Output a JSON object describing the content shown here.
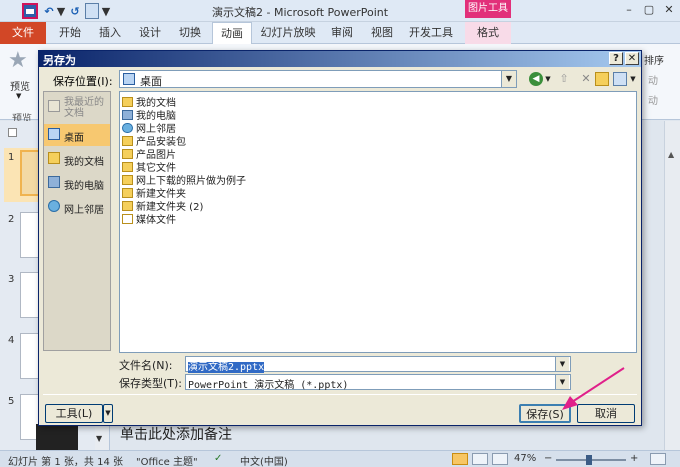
{
  "app": {
    "window_title": "演示文稿2 - Microsoft PowerPoint",
    "context_tab_title": "图片工具",
    "window_controls": {
      "minimize": "–",
      "maximize": "▢",
      "close": "✕"
    }
  },
  "ribbon": {
    "file_tab": "文件",
    "tabs": [
      "开始",
      "插入",
      "设计",
      "切换",
      "动画",
      "幻灯片放映",
      "审阅",
      "视图",
      "开发工具",
      "格式"
    ],
    "active_tab": "动画",
    "preview_button": "预览",
    "preview_group": "预览",
    "sort_label": "排序",
    "faded_1": "动",
    "faded_2": "动"
  },
  "slide_pane": {
    "slide_numbers": [
      "1",
      "2",
      "3",
      "4",
      "5"
    ]
  },
  "notes": {
    "placeholder": "单击此处添加备注"
  },
  "status": {
    "slide_info": "幻灯片 第 1 张，共 14 张",
    "theme": "\"Office 主题\"",
    "language": "中文(中国)",
    "zoom": "47%",
    "zoom_minus": "−",
    "zoom_plus": "+"
  },
  "dialog": {
    "title": "另存为",
    "help": "?",
    "close": "✕",
    "save_in_label": "保存位置(I):",
    "save_in_value": "桌面",
    "places": [
      {
        "label": "我最近的文档"
      },
      {
        "label": "桌面"
      },
      {
        "label": "我的文档"
      },
      {
        "label": "我的电脑"
      },
      {
        "label": "网上邻居"
      }
    ],
    "files": [
      {
        "name": "我的文档",
        "icon": "docs"
      },
      {
        "name": "我的电脑",
        "icon": "pc"
      },
      {
        "name": "网上邻居",
        "icon": "net"
      },
      {
        "name": "产品安装包",
        "icon": "folder"
      },
      {
        "name": "产品图片",
        "icon": "folder"
      },
      {
        "name": "其它文件",
        "icon": "folder"
      },
      {
        "name": "网上下载的照片做为例子",
        "icon": "folder"
      },
      {
        "name": "新建文件夹",
        "icon": "folder"
      },
      {
        "name": "新建文件夹 (2)",
        "icon": "folder"
      },
      {
        "name": "媒体文件",
        "icon": "media"
      }
    ],
    "filename_label": "文件名(N):",
    "filename_value": "演示文稿2.pptx",
    "savetype_label": "保存类型(T):",
    "savetype_value": "PowerPoint 演示文稿 (*.pptx)",
    "tools_button": "工具(L)",
    "save_button": "保存(S)",
    "cancel_button": "取消"
  },
  "colors": {
    "file_tab": "#d24726",
    "context_tab": "#e2307a",
    "annotation_arrow": "#e0208a",
    "title_gradient_start": "#0a246a"
  }
}
